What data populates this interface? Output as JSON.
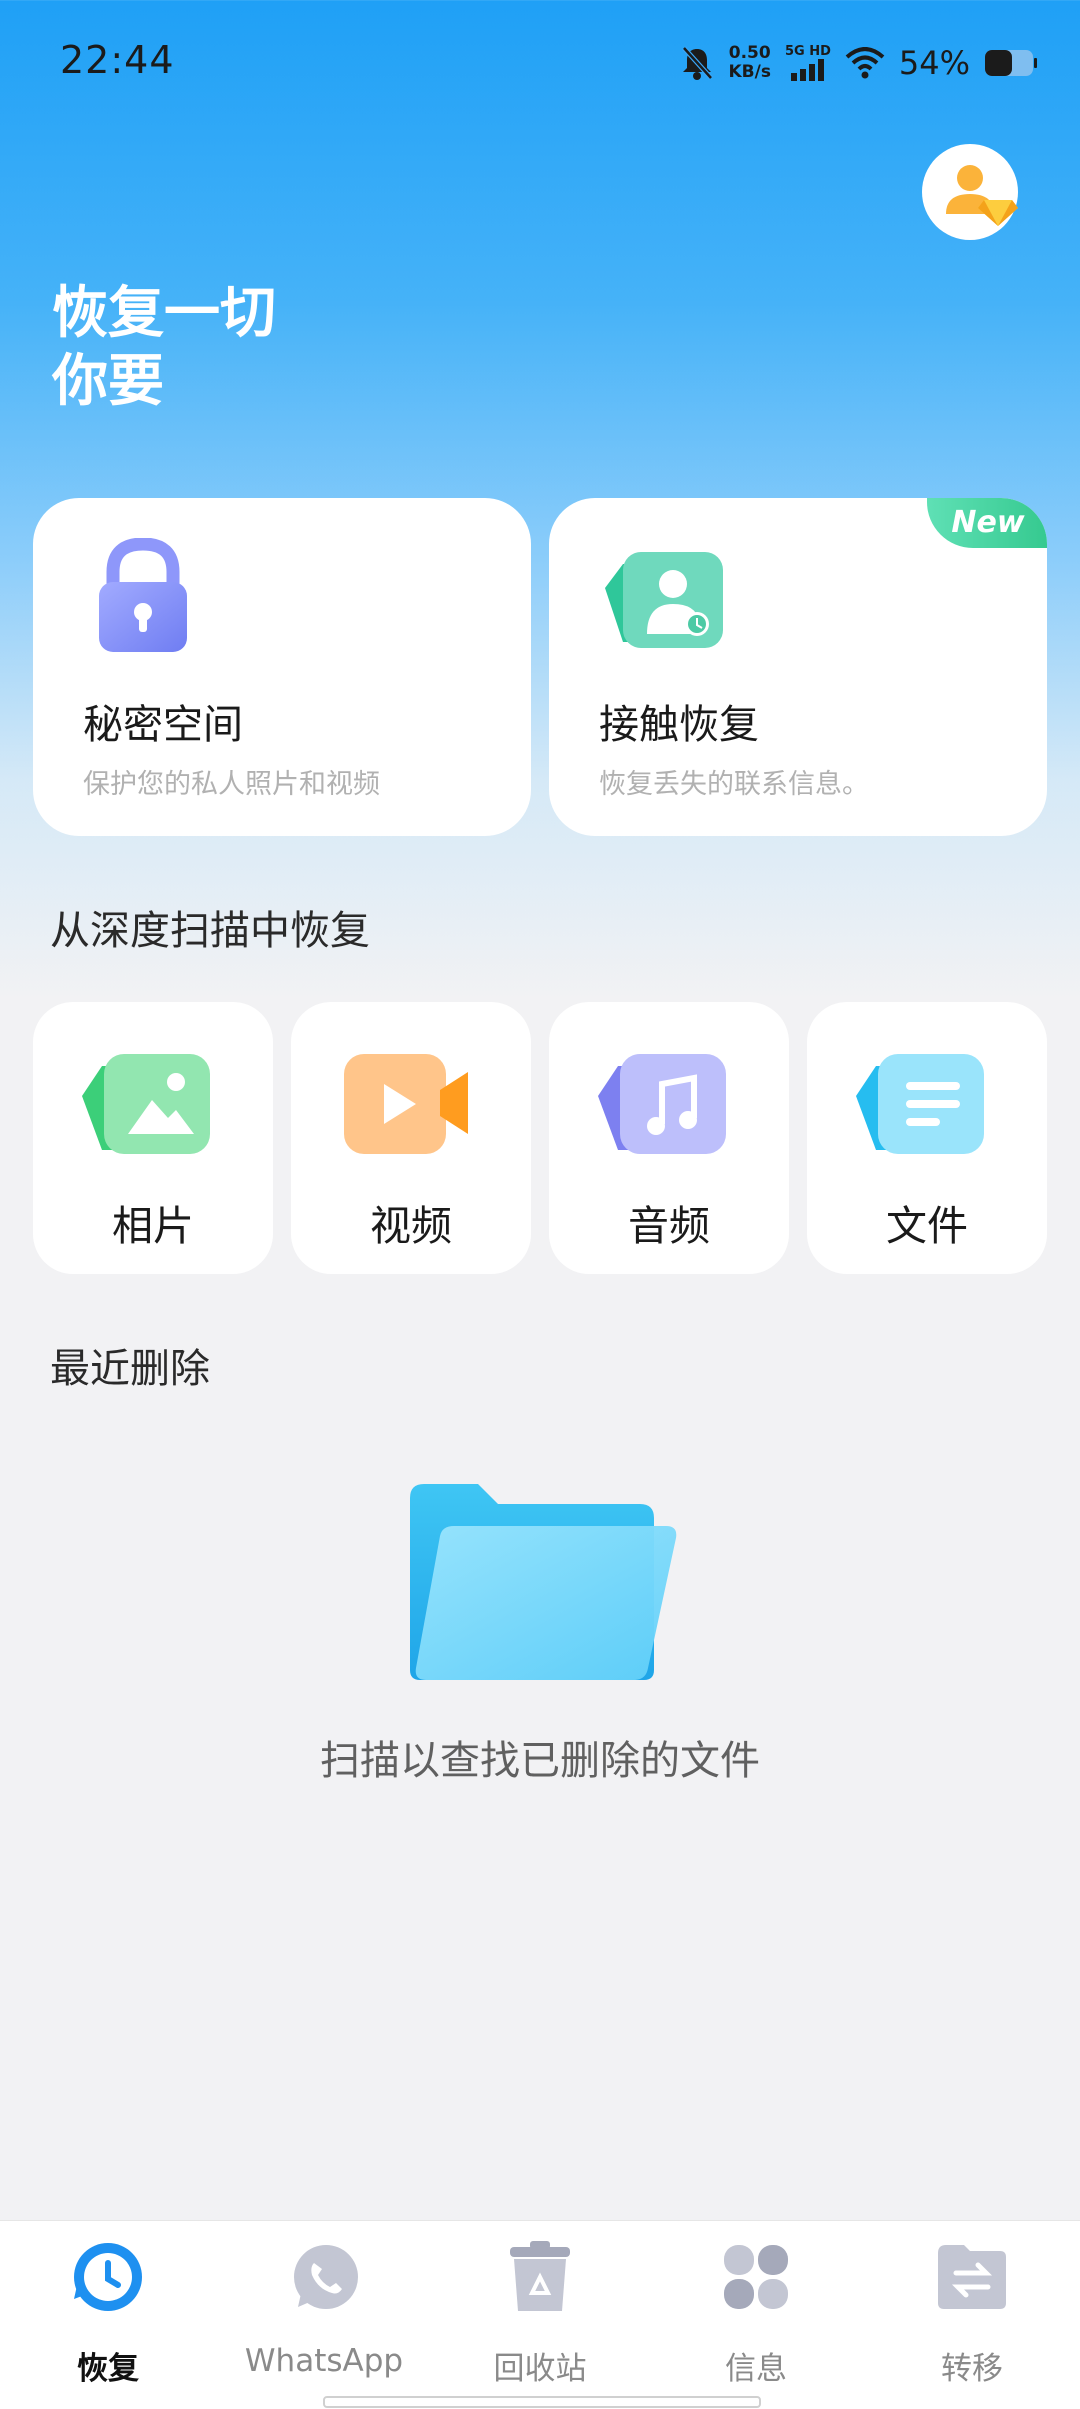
{
  "status_bar": {
    "time": "22:44",
    "speed_value": "0.50",
    "speed_unit": "KB/s",
    "network": "5G HD",
    "battery": "54%"
  },
  "header": {
    "title_line1": "恢复一切",
    "title_line2": "你要"
  },
  "feature_cards": [
    {
      "title": "秘密空间",
      "subtitle": "保护您的私人照片和视频",
      "icon": "lock-icon"
    },
    {
      "title": "接触恢复",
      "subtitle": "恢复丢失的联系信息。",
      "icon": "contact-icon",
      "badge": "New"
    }
  ],
  "deep_scan": {
    "title": "从深度扫描中恢复",
    "items": [
      {
        "label": "相片",
        "icon": "photo-icon",
        "color": "#4cd58b"
      },
      {
        "label": "视频",
        "icon": "video-icon",
        "color": "#ffa43a"
      },
      {
        "label": "音频",
        "icon": "audio-icon",
        "color": "#8c8df5"
      },
      {
        "label": "文件",
        "icon": "file-icon",
        "color": "#35c6f2"
      }
    ]
  },
  "recent": {
    "title": "最近删除",
    "empty_text": "扫描以查找已删除的文件"
  },
  "bottom_nav": [
    {
      "label": "恢复",
      "icon": "clock-icon",
      "active": true
    },
    {
      "label": "WhatsApp",
      "icon": "whatsapp-icon",
      "active": false
    },
    {
      "label": "回收站",
      "icon": "trash-icon",
      "active": false
    },
    {
      "label": "信息",
      "icon": "grid-icon",
      "active": false
    },
    {
      "label": "转移",
      "icon": "transfer-icon",
      "active": false
    }
  ],
  "colors": {
    "accent": "#1e96f0",
    "new_badge": "#3fcf98"
  }
}
